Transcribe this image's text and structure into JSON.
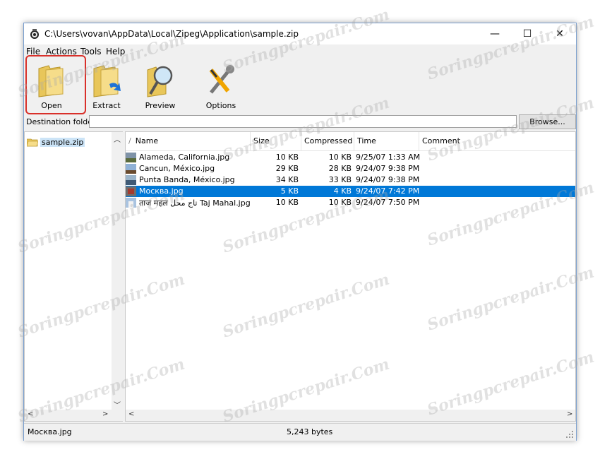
{
  "window": {
    "title": "C:\\Users\\vovan\\AppData\\Local\\Zipeg\\Application\\sample.zip",
    "minimize_glyph": "—",
    "maximize_glyph": "☐",
    "close_glyph": "✕"
  },
  "menu": [
    "File",
    "Actions",
    "Tools",
    "Help"
  ],
  "toolbar": {
    "buttons": [
      {
        "label": "Open",
        "icon": "folder-icon"
      },
      {
        "label": "Extract",
        "icon": "folder-extract-icon"
      },
      {
        "label": "Preview",
        "icon": "magnifier-icon"
      },
      {
        "label": "Options",
        "icon": "tools-icon"
      }
    ]
  },
  "destination": {
    "label": "Destination folder:",
    "value": "",
    "browse_label": "Browse..."
  },
  "tree": {
    "items": [
      {
        "label": "sample.zip",
        "icon": "folder-icon"
      }
    ]
  },
  "columns": {
    "sort_indicator": "/",
    "name": "Name",
    "size": "Size",
    "compressed": "Compressed",
    "time": "Time",
    "comment": "Comment"
  },
  "files": [
    {
      "name": "Alameda, California.jpg",
      "size": "10 KB",
      "compressed": "10 KB",
      "time": "9/25/07 1:33 AM",
      "comment": ""
    },
    {
      "name": "Cancun, México.jpg",
      "size": "29 KB",
      "compressed": "28 KB",
      "time": "9/24/07 9:38 PM",
      "comment": ""
    },
    {
      "name": "Punta Banda, México.jpg",
      "size": "34 KB",
      "compressed": "33 KB",
      "time": "9/24/07 9:38 PM",
      "comment": ""
    },
    {
      "name": "Москва.jpg",
      "size": "5 KB",
      "compressed": "4 KB",
      "time": "9/24/07 7:42 PM",
      "comment": "",
      "selected": true
    },
    {
      "name": "ताज महल تاج محل Taj Mahal.jpg",
      "size": "10 KB",
      "compressed": "10 KB",
      "time": "9/24/07 7:50 PM",
      "comment": ""
    }
  ],
  "status": {
    "selected_file": "Москва.jpg",
    "bytes": "5,243 bytes"
  },
  "watermark": "Soringpcrepair.Com",
  "colors": {
    "selection": "#0078d7",
    "highlight_border": "#d9302a"
  }
}
